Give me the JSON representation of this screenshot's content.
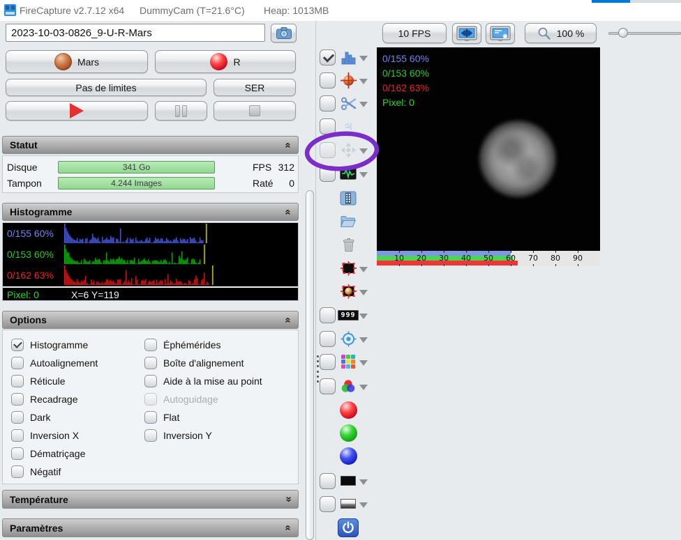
{
  "titlebar": {
    "app_title": "FireCapture v2.7.12 x64",
    "camera_info": "DummyCam (T=21.6°C)",
    "heap": "Heap: 1013MB"
  },
  "capture": {
    "filename": "2023-10-03-0826_9-U-R-Mars",
    "target_button": "Mars",
    "filter_button": "R",
    "limits_button": "Pas de limites",
    "format_button": "SER"
  },
  "status": {
    "title": "Statut",
    "disk_label": "Disque",
    "disk_value": "341 Go",
    "fps_label": "FPS",
    "fps_value": "312",
    "buffer_label": "Tampon",
    "buffer_value": "4.244 Images",
    "dropped_label": "Raté",
    "dropped_value": "0"
  },
  "histogram": {
    "title": "Histogramme",
    "channels": [
      {
        "name": "blue",
        "label": "0/155 60%",
        "color": "#6f86f2",
        "bar_color": "#5566e8",
        "marker": 0.608
      },
      {
        "name": "green",
        "label": "0/153 60%",
        "color": "#22cc22",
        "bar_color": "#15bb15",
        "marker": 0.6
      },
      {
        "name": "red",
        "label": "0/162 63%",
        "color": "#ee2222",
        "bar_color": "#e32222",
        "marker": 0.635
      }
    ],
    "pixel_label": "Pixel: 0",
    "cursor_pos": "X=6 Y=119"
  },
  "options": {
    "title": "Options",
    "left": [
      {
        "label": "Histogramme",
        "checked": true
      },
      {
        "label": "Autoalignement"
      },
      {
        "label": "Réticule"
      },
      {
        "label": "Recadrage"
      },
      {
        "label": "Dark"
      },
      {
        "label": "Inversion X"
      },
      {
        "label": "Dématriçage"
      },
      {
        "label": "Négatif"
      }
    ],
    "right": [
      {
        "label": "Éphémérides"
      },
      {
        "label": "Boîte d'alignement"
      },
      {
        "label": "Aide à la mise au point"
      },
      {
        "label": "Autoguidage",
        "disabled": true
      },
      {
        "label": "Flat"
      },
      {
        "label": "Inversion Y"
      }
    ]
  },
  "temperature": {
    "title": "Température"
  },
  "parameters": {
    "title": "Paramètres"
  },
  "preview_toolbar": {
    "fps_button": "10 FPS",
    "zoom_button": "100 %"
  },
  "preview": {
    "overlay": [
      "0/155 60%",
      "0/153 60%",
      "0/162 63%",
      "Pixel: 0"
    ],
    "overlay_colors": [
      "#6f86f2",
      "#22cc22",
      "#ee2222",
      "#22dd22"
    ],
    "scale_ticks": [
      "10",
      "20",
      "30",
      "40",
      "50",
      "60",
      "70",
      "80",
      "90"
    ],
    "scale_levels": {
      "blue": 0.6,
      "green": 0.61,
      "red": 0.63
    },
    "scale_colors": {
      "blue": "#7e97e6",
      "green": "#4ed44e",
      "red": "#ef3535"
    }
  },
  "toolbar": {
    "counter_label": "999",
    "items": [
      {
        "name": "histogram",
        "icon": "histogram-icon",
        "checkbox": true,
        "checked": true,
        "arrow": true
      },
      {
        "name": "autoalign",
        "icon": "planet-crosshair-icon",
        "checkbox": true,
        "arrow": true
      },
      {
        "name": "cut",
        "icon": "scissors-icon",
        "checkbox": true,
        "arrow": true
      },
      {
        "name": "jupiter",
        "icon": "jupiter-icon",
        "checkbox": true
      },
      {
        "name": "move",
        "icon": "move-icon",
        "checkbox": true,
        "disabled": true,
        "arrow": true,
        "annotated": true
      },
      {
        "name": "signal",
        "icon": "waveform-icon",
        "checkbox": true,
        "arrow": true
      },
      {
        "name": "capture-video",
        "icon": "film-icon",
        "button": true
      },
      {
        "name": "open-folder",
        "icon": "folder-icon",
        "button": true
      },
      {
        "name": "delete",
        "icon": "trash-icon",
        "button": true
      },
      {
        "name": "roi",
        "icon": "roi-icon",
        "button": true,
        "arrow": true
      },
      {
        "name": "roi-planet",
        "icon": "roi-planet-icon",
        "button": true,
        "arrow": true
      },
      {
        "name": "counter",
        "icon": "counter-icon",
        "checkbox": true,
        "arrow": true
      },
      {
        "name": "target",
        "icon": "target-icon",
        "checkbox": true,
        "arrow": true
      },
      {
        "name": "palette",
        "icon": "palette-icon",
        "checkbox": true,
        "arrow": true
      },
      {
        "name": "rgb",
        "icon": "rgb-icon",
        "checkbox": true,
        "arrow": true
      },
      {
        "name": "red-channel",
        "icon": "red-orb-icon",
        "button": true
      },
      {
        "name": "green-channel",
        "icon": "green-orb-icon",
        "button": true
      },
      {
        "name": "blue-channel",
        "icon": "blue-orb-icon",
        "button": true
      },
      {
        "name": "dark",
        "icon": "dark-icon",
        "checkbox": true,
        "arrow": true
      },
      {
        "name": "flat",
        "icon": "flat-icon",
        "checkbox": true,
        "arrow": true
      },
      {
        "name": "power",
        "icon": "power-icon",
        "button": true
      }
    ]
  },
  "annotation": {
    "color": "#7b2cc9"
  }
}
